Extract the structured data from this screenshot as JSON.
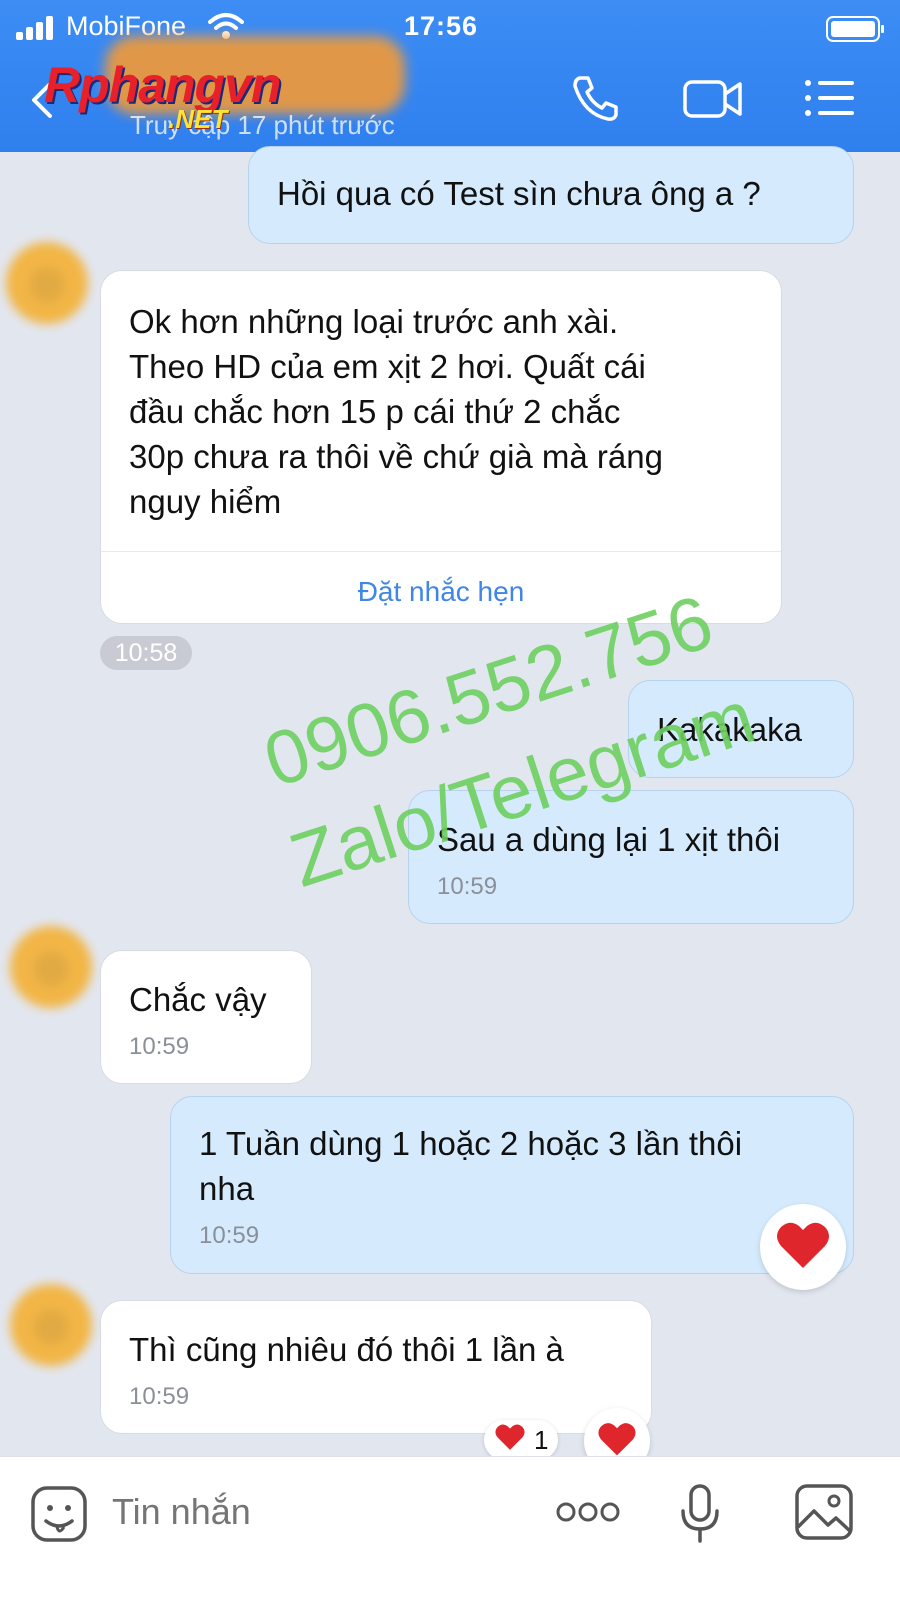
{
  "status_bar": {
    "carrier": "MobiFone",
    "time": "17:56"
  },
  "header": {
    "logo_text": "Rphangvn",
    "logo_sub": ".NET",
    "subtitle": "Truy cập 17 phút trước",
    "icons": [
      "back-icon",
      "phone-icon",
      "video-call-icon",
      "menu-icon"
    ]
  },
  "messages": [
    {
      "side": "mine",
      "text": "Hồi qua có Test sìn chưa ông a ?",
      "time": ""
    },
    {
      "side": "theirs",
      "text": "Ok hơn những loại trước anh xài.\nTheo HD của em xịt 2 hơi. Quất cái\nđầu chắc hơn 15 p cái thứ 2 chắc\n30p chưa ra thôi  về chứ già mà ráng\nnguy hiểm",
      "action": "Đặt nhắc hẹn",
      "time": "10:58"
    },
    {
      "side": "mine",
      "text": "Kakakaka",
      "time": ""
    },
    {
      "side": "mine",
      "text": "Sau a dùng lại 1 xịt thôi",
      "time": "10:59"
    },
    {
      "side": "theirs",
      "text": "Chắc vậy",
      "time": "10:59"
    },
    {
      "side": "mine",
      "text": "1 Tuần dùng 1 hoặc 2 hoặc 3 lần thôi\nnha",
      "time": "10:59"
    },
    {
      "side": "theirs",
      "text": "Thì cũng nhiêu đó thôi 1 lần à",
      "time": "10:59",
      "reaction_count": "1"
    }
  ],
  "watermark": {
    "line1": "0906.552.756",
    "line2": "Zalo/Telegram",
    "color": "#6dd05f"
  },
  "input_bar": {
    "placeholder": "Tin nhắn"
  },
  "colors": {
    "header": "#2f7fee",
    "mine_bubble": "#d5ebfd",
    "theirs_bubble": "#ffffff",
    "background": "#e2e6ef",
    "heart": "#e0262d"
  }
}
